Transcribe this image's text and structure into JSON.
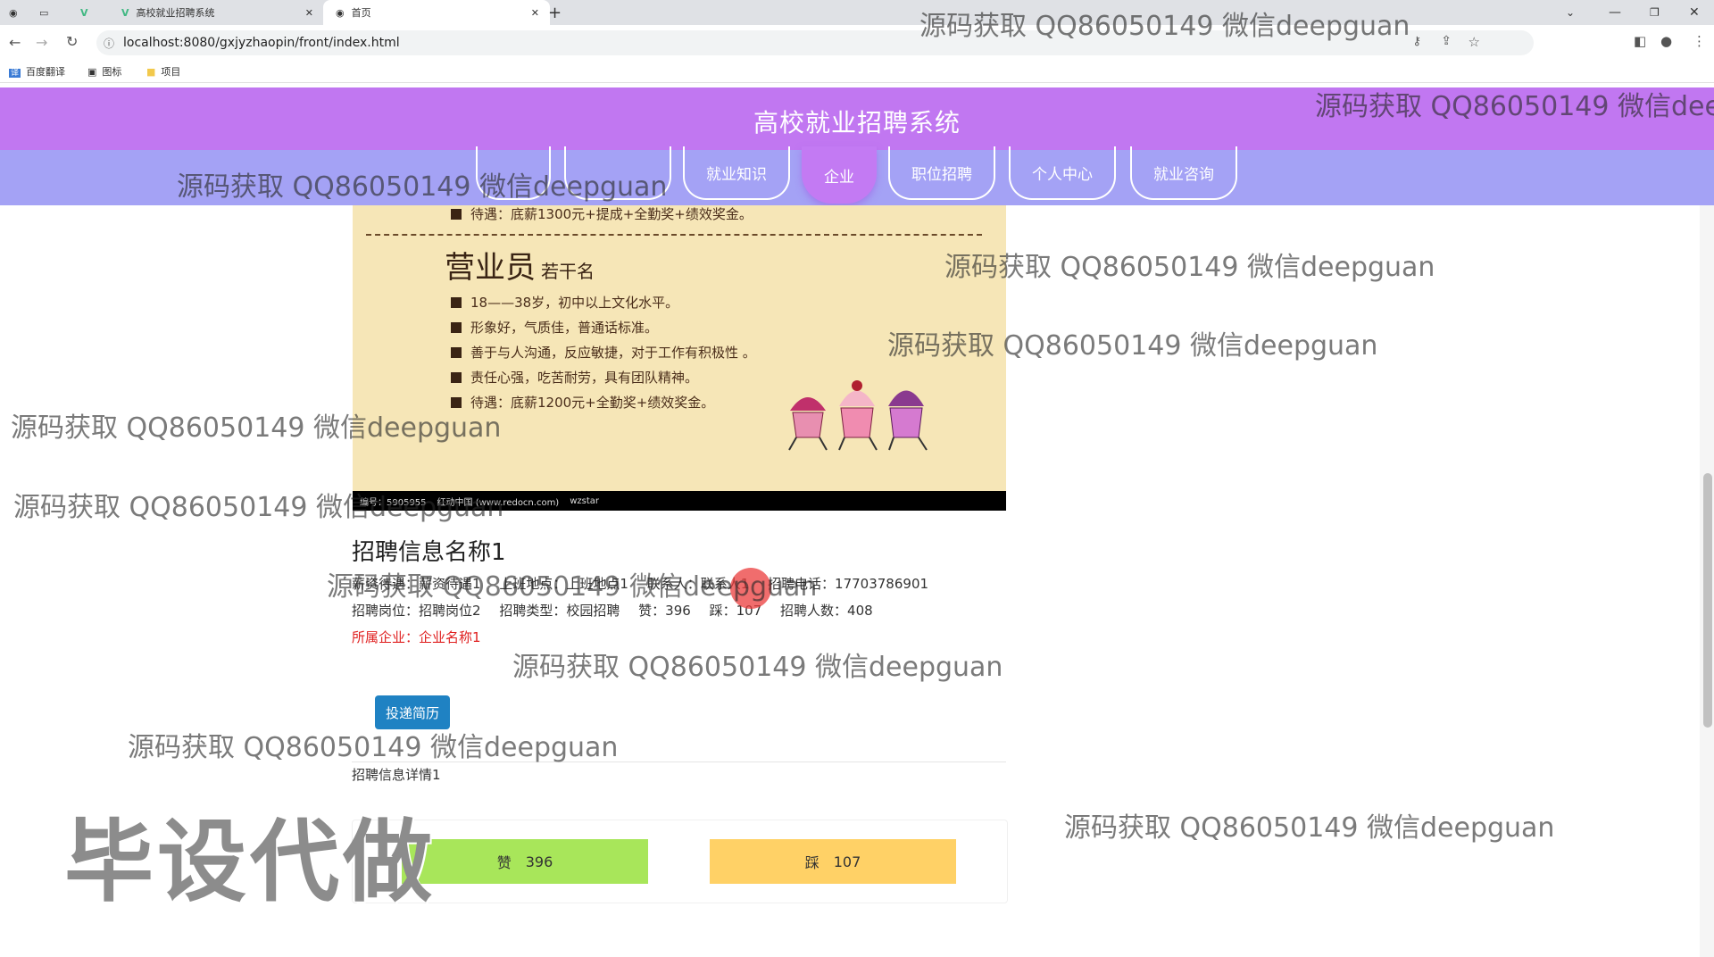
{
  "browser": {
    "tabs": [
      {
        "title": ""
      },
      {
        "title": ""
      },
      {
        "title": ""
      },
      {
        "title": "高校就业招聘系统"
      },
      {
        "title": "首页"
      }
    ],
    "url": "localhost:8080/gxjyzhaopin/front/index.html",
    "bookmarks": [
      "百度翻译",
      "图标",
      "项目"
    ]
  },
  "site": {
    "title": "高校就业招聘系统",
    "nav": [
      "",
      "",
      "就业知识",
      "企业",
      "职位招聘",
      "个人中心",
      "就业咨询"
    ]
  },
  "poster": {
    "top_line": "待遇：底薪1300元+提成+全勤奖+绩效奖金。",
    "job_title": "营业员",
    "job_count": "若干名",
    "requirements": [
      "18——38岁，初中以上文化水平。",
      "形象好，气质佳，普通话标准。",
      "善于与人沟通，反应敏捷，对于工作有积极性 。",
      "责任心强，吃苦耐劳，具有团队精神。",
      "待遇：底薪1200元+全勤奖+绩效奖金。"
    ],
    "footer": [
      "编号：5905955",
      "红动中国 (www.redocn.com)",
      "wzstar"
    ]
  },
  "job": {
    "name": "招聘信息名称1",
    "row1": [
      "薪资待遇：",
      "薪资待遇1",
      "上班地点：",
      "上班地点1",
      "联系人：",
      "联系人1",
      "招聘电话：",
      "17703786901"
    ],
    "row2": [
      {
        "label": "招聘岗位：",
        "value": "招聘岗位2"
      },
      {
        "label": "招聘类型：",
        "value": "校园招聘"
      },
      {
        "label": "赞：",
        "value": "396"
      },
      {
        "label": "踩：",
        "value": "107"
      },
      {
        "label": "招聘人数：",
        "value": "408"
      }
    ],
    "company_label": "所属企业：",
    "company_value": "企业名称1",
    "apply_label": "投递简历",
    "detail": "招聘信息详情1",
    "like_label": "赞",
    "like_count": "396",
    "dislike_label": "踩",
    "dislike_count": "107"
  },
  "watermark": {
    "text": "源码获取 QQ86050149 微信deepguan",
    "partial_text": "源码获取 QQ86050149 微信deep",
    "big_text": "毕设代做"
  },
  "colors": {
    "header": "#c177f1",
    "nav": "#a4a2f5",
    "nav_active": "#c37af3",
    "like": "#a8e65a",
    "dislike": "#ffd166",
    "apply": "#1f82c3"
  }
}
